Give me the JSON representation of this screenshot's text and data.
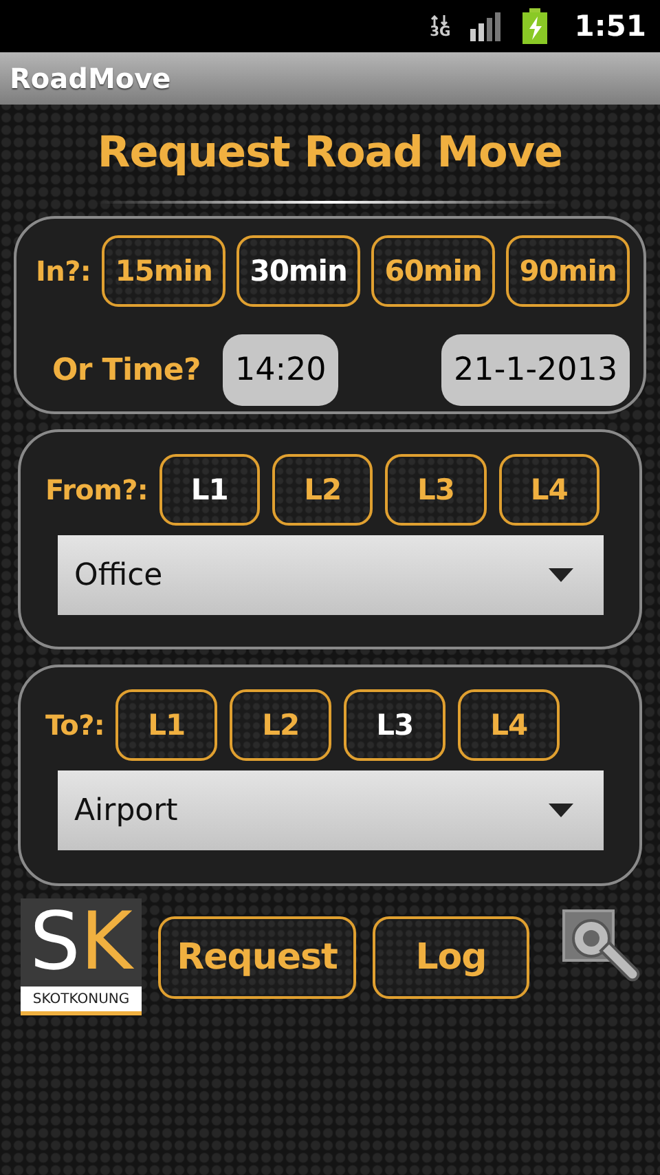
{
  "status_bar": {
    "network": "3G",
    "time": "1:51"
  },
  "app_bar": {
    "title": "RoadMove"
  },
  "heading": "Request Road Move",
  "when": {
    "label": "In?:",
    "durations": [
      {
        "label": "15min",
        "selected": false
      },
      {
        "label": "30min",
        "selected": true
      },
      {
        "label": "60min",
        "selected": false
      },
      {
        "label": "90min",
        "selected": false
      }
    ],
    "time_label": "Or Time?",
    "time": "14:20",
    "date": "21-1-2013"
  },
  "from": {
    "label": "From?:",
    "levels": [
      {
        "label": "L1",
        "selected": true
      },
      {
        "label": "L2",
        "selected": false
      },
      {
        "label": "L3",
        "selected": false
      },
      {
        "label": "L4",
        "selected": false
      }
    ],
    "place": "Office"
  },
  "to": {
    "label": "To?:",
    "levels": [
      {
        "label": "L1",
        "selected": false
      },
      {
        "label": "L2",
        "selected": false
      },
      {
        "label": "L3",
        "selected": true
      },
      {
        "label": "L4",
        "selected": false
      }
    ],
    "place": "Airport"
  },
  "logo": {
    "initials": [
      "S",
      "K"
    ],
    "caption": "SKOTKONUNG"
  },
  "actions": [
    "Request",
    "Log"
  ]
}
